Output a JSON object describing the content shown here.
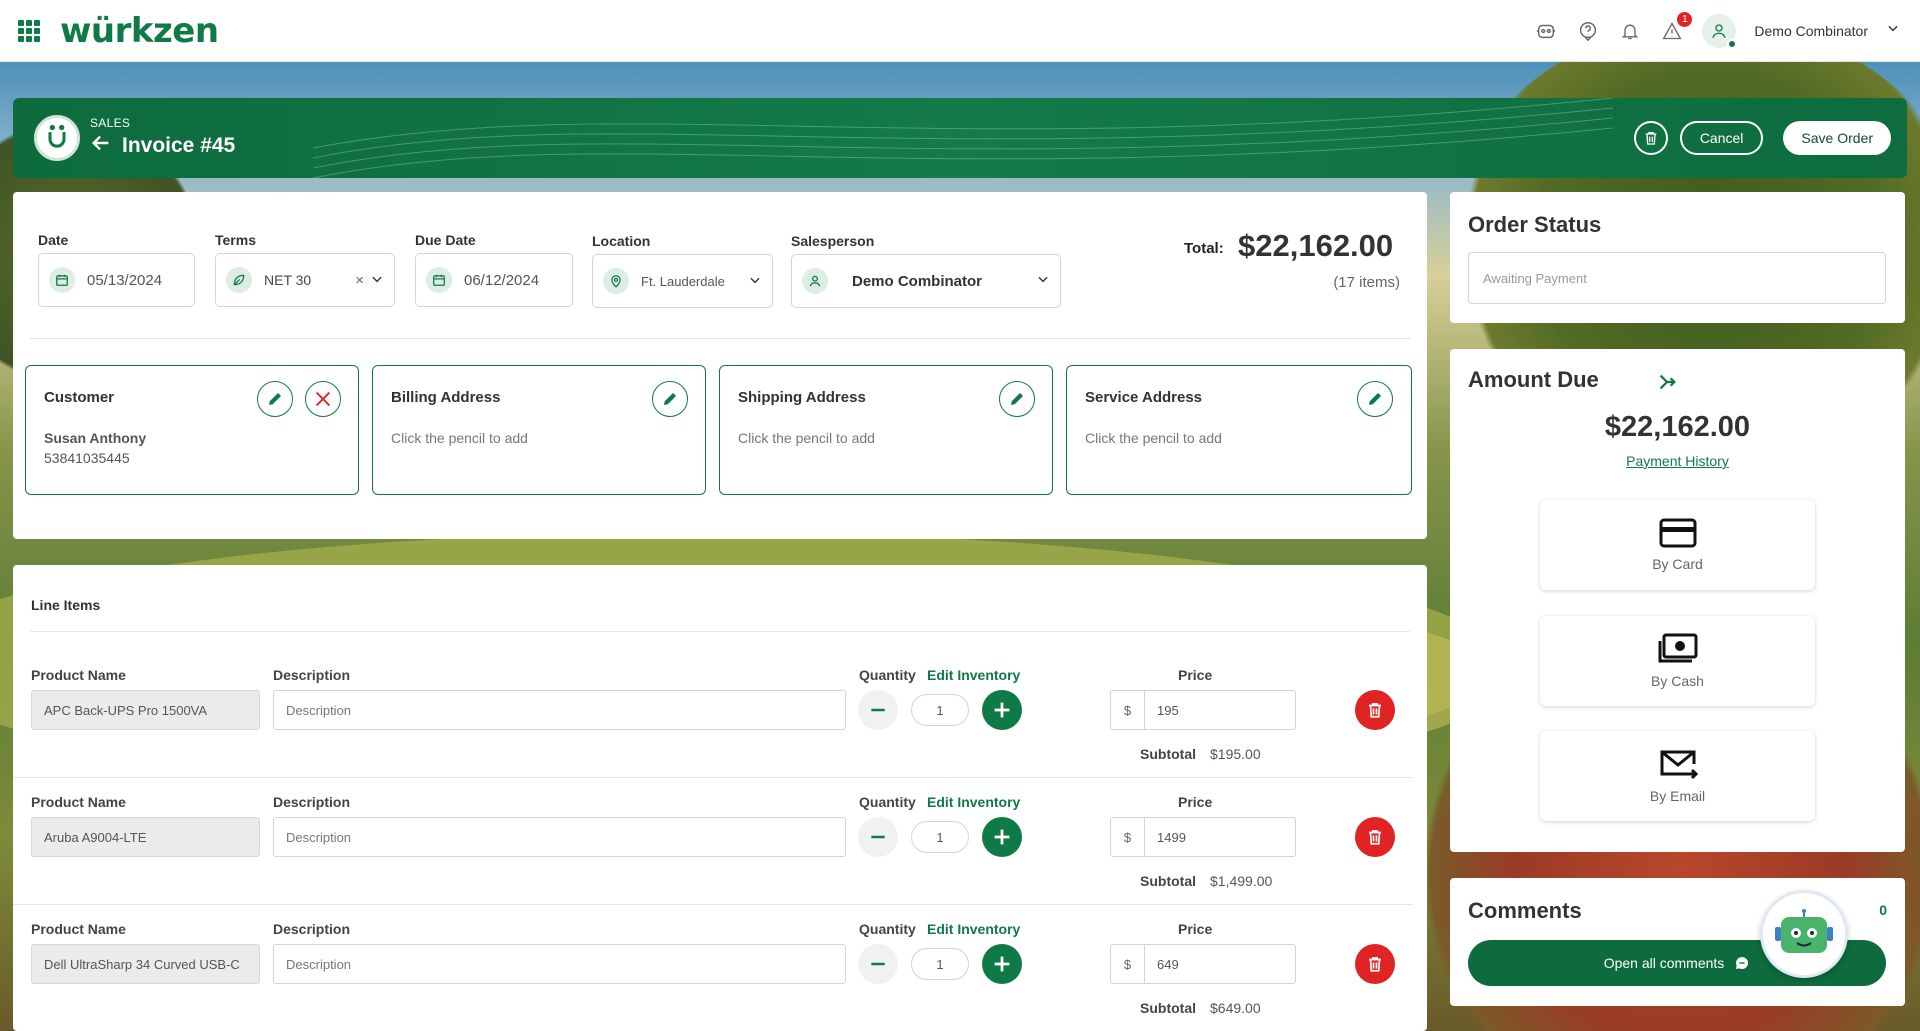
{
  "app": {
    "logo": "würkzen"
  },
  "topbar": {
    "notification_count": "1",
    "user_name": "Demo Combinator"
  },
  "header": {
    "section": "SALES",
    "title": "Invoice #45",
    "cancel_label": "Cancel",
    "save_label": "Save Order"
  },
  "form": {
    "date_label": "Date",
    "date_value": "05/13/2024",
    "terms_label": "Terms",
    "terms_value": "NET 30",
    "due_label": "Due Date",
    "due_value": "06/12/2024",
    "location_label": "Location",
    "location_value": "Ft. Lauderdale",
    "salesperson_label": "Salesperson",
    "salesperson_value": "Demo Combinator",
    "total_label": "Total:",
    "total_value": "$22,162.00",
    "items_count": "(17 items)"
  },
  "addresses": {
    "customer_title": "Customer",
    "customer_name": "Susan Anthony",
    "customer_phone": "53841035445",
    "billing_title": "Billing Address",
    "billing_text": "Click the pencil to add",
    "shipping_title": "Shipping Address",
    "shipping_text": "Click the pencil to add",
    "service_title": "Service Address",
    "service_text": "Click the pencil to add"
  },
  "line_items": {
    "title": "Line Items",
    "product_label": "Product Name",
    "description_label": "Description",
    "quantity_label": "Quantity",
    "edit_inventory_label": "Edit Inventory",
    "price_label": "Price",
    "subtotal_label": "Subtotal",
    "description_placeholder": "Description",
    "currency": "$",
    "rows": [
      {
        "product": "APC Back-UPS Pro 1500VA",
        "quantity": "1",
        "price": "195",
        "subtotal": "$195.00"
      },
      {
        "product": "Aruba A9004-LTE",
        "quantity": "1",
        "price": "1499",
        "subtotal": "$1,499.00"
      },
      {
        "product": "Dell UltraSharp 34 Curved USB-C",
        "quantity": "1",
        "price": "649",
        "subtotal": "$649.00"
      }
    ]
  },
  "order_status": {
    "title": "Order Status",
    "value": "Awaiting Payment"
  },
  "amount_due": {
    "title": "Amount Due",
    "value": "$22,162.00",
    "payment_history": "Payment History",
    "by_card": "By Card",
    "by_cash": "By Cash",
    "by_email": "By Email"
  },
  "comments": {
    "title": "Comments",
    "count": "0",
    "open_label": "Open all comments"
  },
  "colors": {
    "brand": "#0f7a46",
    "danger": "#e02424"
  }
}
